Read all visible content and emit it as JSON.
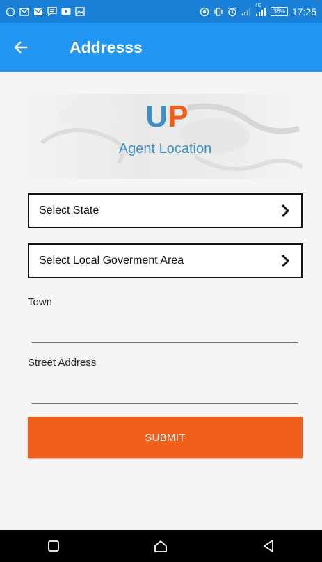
{
  "status_bar": {
    "time": "17:25",
    "battery": "38",
    "network": "4G",
    "left_icons": [
      "whatsapp-icon",
      "gmail-icon",
      "gmail-icon",
      "message-icon",
      "youtube-icon",
      "image-icon"
    ],
    "right_icons": [
      "location-icon",
      "vibrate-icon",
      "alarm-icon",
      "signal-icon",
      "signal-4g-icon",
      "battery-icon"
    ]
  },
  "app_bar": {
    "title": "Addresss",
    "back_icon": "arrow-left-icon"
  },
  "banner": {
    "logo_text": "UP",
    "logo_colors": [
      "#3a8fc7",
      "#f0601a"
    ],
    "caption": "Agent Location"
  },
  "form": {
    "state_select": {
      "label": "Select State",
      "icon": "chevron-right-icon"
    },
    "lga_select": {
      "label": "Select Local Goverment Area",
      "icon": "chevron-right-icon"
    },
    "town": {
      "label": "Town",
      "value": ""
    },
    "street": {
      "label": "Street Address",
      "value": ""
    },
    "submit_label": "SUBMIT"
  },
  "nav_bar": {
    "icons": [
      "square-icon",
      "home-icon",
      "back-triangle-icon"
    ]
  },
  "colors": {
    "app_bar": "#2196f3",
    "status_bar": "#1a7fd6",
    "submit": "#f0601a",
    "caption": "#3a8fc7"
  }
}
